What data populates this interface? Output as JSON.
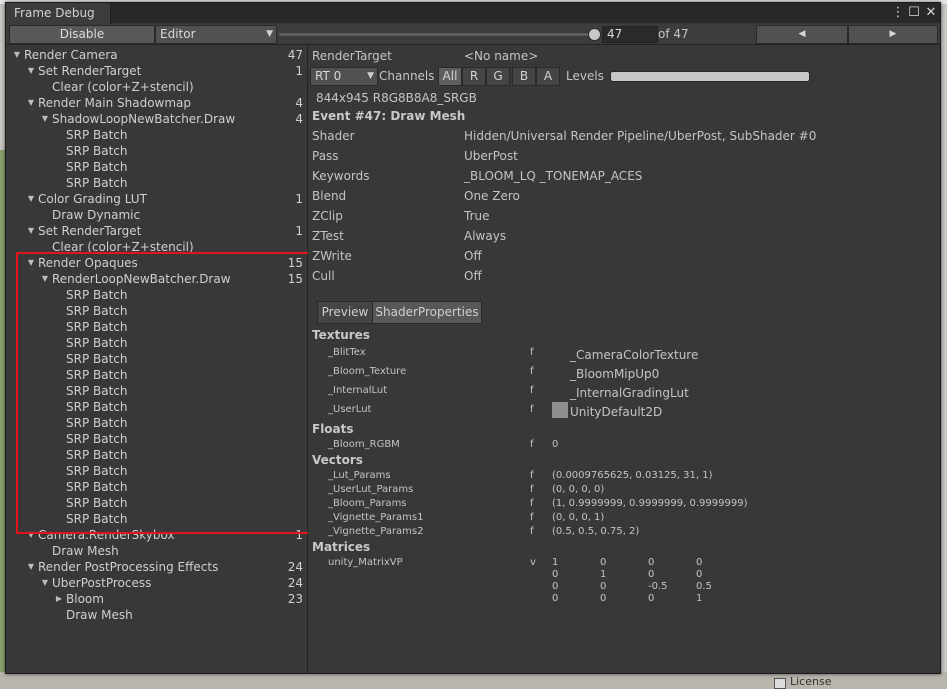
{
  "window": {
    "title": "Frame Debug",
    "icons": {
      "menu": "kebab-menu-icon",
      "maximize": "maximize-icon",
      "close": "close-icon"
    }
  },
  "toolbar": {
    "disable_label": "Disable",
    "target_dropdown": "Editor",
    "frame_value": "47",
    "frame_total": "of 47",
    "frame_slider_fraction": 1.0,
    "prev_icon": "triangle-left-icon",
    "next_icon": "triangle-right-icon"
  },
  "tree": [
    {
      "label": "Render Camera",
      "count": "47",
      "depth": 0,
      "arrow": "expanded"
    },
    {
      "label": "Set RenderTarget",
      "count": "1",
      "depth": 1,
      "arrow": "expanded"
    },
    {
      "label": "Clear (color+Z+stencil)",
      "count": "",
      "depth": 2,
      "arrow": "none"
    },
    {
      "label": "Render Main Shadowmap",
      "count": "4",
      "depth": 1,
      "arrow": "expanded"
    },
    {
      "label": "ShadowLoopNewBatcher.Draw",
      "count": "4",
      "depth": 2,
      "arrow": "expanded"
    },
    {
      "label": "SRP Batch",
      "count": "",
      "depth": 3,
      "arrow": "none"
    },
    {
      "label": "SRP Batch",
      "count": "",
      "depth": 3,
      "arrow": "none"
    },
    {
      "label": "SRP Batch",
      "count": "",
      "depth": 3,
      "arrow": "none"
    },
    {
      "label": "SRP Batch",
      "count": "",
      "depth": 3,
      "arrow": "none"
    },
    {
      "label": "Color Grading LUT",
      "count": "1",
      "depth": 1,
      "arrow": "expanded"
    },
    {
      "label": "Draw Dynamic",
      "count": "",
      "depth": 2,
      "arrow": "none"
    },
    {
      "label": "Set RenderTarget",
      "count": "1",
      "depth": 1,
      "arrow": "expanded"
    },
    {
      "label": "Clear (color+Z+stencil)",
      "count": "",
      "depth": 2,
      "arrow": "none"
    },
    {
      "label": "Render Opaques",
      "count": "15",
      "depth": 1,
      "arrow": "expanded"
    },
    {
      "label": "RenderLoopNewBatcher.Draw",
      "count": "15",
      "depth": 2,
      "arrow": "expanded"
    },
    {
      "label": "SRP Batch",
      "count": "",
      "depth": 3,
      "arrow": "none"
    },
    {
      "label": "SRP Batch",
      "count": "",
      "depth": 3,
      "arrow": "none"
    },
    {
      "label": "SRP Batch",
      "count": "",
      "depth": 3,
      "arrow": "none"
    },
    {
      "label": "SRP Batch",
      "count": "",
      "depth": 3,
      "arrow": "none"
    },
    {
      "label": "SRP Batch",
      "count": "",
      "depth": 3,
      "arrow": "none"
    },
    {
      "label": "SRP Batch",
      "count": "",
      "depth": 3,
      "arrow": "none"
    },
    {
      "label": "SRP Batch",
      "count": "",
      "depth": 3,
      "arrow": "none"
    },
    {
      "label": "SRP Batch",
      "count": "",
      "depth": 3,
      "arrow": "none"
    },
    {
      "label": "SRP Batch",
      "count": "",
      "depth": 3,
      "arrow": "none"
    },
    {
      "label": "SRP Batch",
      "count": "",
      "depth": 3,
      "arrow": "none"
    },
    {
      "label": "SRP Batch",
      "count": "",
      "depth": 3,
      "arrow": "none"
    },
    {
      "label": "SRP Batch",
      "count": "",
      "depth": 3,
      "arrow": "none"
    },
    {
      "label": "SRP Batch",
      "count": "",
      "depth": 3,
      "arrow": "none"
    },
    {
      "label": "SRP Batch",
      "count": "",
      "depth": 3,
      "arrow": "none"
    },
    {
      "label": "SRP Batch",
      "count": "",
      "depth": 3,
      "arrow": "none"
    },
    {
      "label": "Camera.RenderSkybox",
      "count": "1",
      "depth": 1,
      "arrow": "expanded"
    },
    {
      "label": "Draw Mesh",
      "count": "",
      "depth": 2,
      "arrow": "none"
    },
    {
      "label": "Render PostProcessing Effects",
      "count": "24",
      "depth": 1,
      "arrow": "expanded"
    },
    {
      "label": "UberPostProcess",
      "count": "24",
      "depth": 2,
      "arrow": "expanded"
    },
    {
      "label": "Bloom",
      "count": "23",
      "depth": 3,
      "arrow": "collapsed"
    },
    {
      "label": "Draw Mesh",
      "count": "",
      "depth": 3,
      "arrow": "none"
    }
  ],
  "render_target": {
    "label": "RenderTarget",
    "value": "<No name>",
    "rt_dropdown": "RT 0",
    "channels_label": "Channels",
    "channels": [
      "All",
      "R",
      "G",
      "B",
      "A"
    ],
    "active_channel": "All",
    "levels_label": "Levels",
    "format": "844x945 R8G8B8A8_SRGB"
  },
  "event": {
    "title": "Event #47: Draw Mesh",
    "props": [
      {
        "label": "Shader",
        "value": "Hidden/Universal Render Pipeline/UberPost, SubShader #0"
      },
      {
        "label": "Pass",
        "value": "UberPost"
      },
      {
        "label": "Keywords",
        "value": "_BLOOM_LQ _TONEMAP_ACES"
      },
      {
        "label": "Blend",
        "value": "One Zero"
      },
      {
        "label": "ZClip",
        "value": "True"
      },
      {
        "label": "ZTest",
        "value": "Always"
      },
      {
        "label": "ZWrite",
        "value": "Off"
      },
      {
        "label": "Cull",
        "value": "Off"
      }
    ]
  },
  "tabs": [
    "Preview",
    "ShaderProperties"
  ],
  "active_tab": "ShaderProperties",
  "shader_props": {
    "textures_header": "Textures",
    "textures": [
      {
        "name": "_BlitTex",
        "type": "f",
        "value": "_CameraColorTexture",
        "swatch": false
      },
      {
        "name": "_Bloom_Texture",
        "type": "f",
        "value": "_BloomMipUp0",
        "swatch": false
      },
      {
        "name": "_InternalLut",
        "type": "f",
        "value": "_InternalGradingLut",
        "swatch": false
      },
      {
        "name": "_UserLut",
        "type": "f",
        "value": "UnityDefault2D",
        "swatch": true
      }
    ],
    "floats_header": "Floats",
    "floats": [
      {
        "name": "_Bloom_RGBM",
        "type": "f",
        "value": "0"
      }
    ],
    "vectors_header": "Vectors",
    "vectors": [
      {
        "name": "_Lut_Params",
        "type": "f",
        "value": "(0.0009765625, 0.03125, 31, 1)"
      },
      {
        "name": "_UserLut_Params",
        "type": "f",
        "value": "(0, 0, 0, 0)"
      },
      {
        "name": "_Bloom_Params",
        "type": "f",
        "value": "(1, 0.9999999, 0.9999999, 0.9999999)"
      },
      {
        "name": "_Vignette_Params1",
        "type": "f",
        "value": "(0, 0, 0, 1)"
      },
      {
        "name": "_Vignette_Params2",
        "type": "f",
        "value": "(0.5, 0.5, 0.75, 2)"
      }
    ],
    "matrices_header": "Matrices",
    "matrices": [
      {
        "name": "unity_MatrixVP",
        "type": "v",
        "rows": [
          [
            "1",
            "0",
            "0",
            "0"
          ],
          [
            "0",
            "1",
            "0",
            "0"
          ],
          [
            "0",
            "0",
            "-0.5",
            "0.5"
          ],
          [
            "0",
            "0",
            "0",
            "1"
          ]
        ]
      }
    ]
  },
  "background": {
    "license_label": "License"
  },
  "colors": {
    "highlight": "#e0161c",
    "panel": "#383838",
    "toolbar": "#3c3c3c"
  }
}
